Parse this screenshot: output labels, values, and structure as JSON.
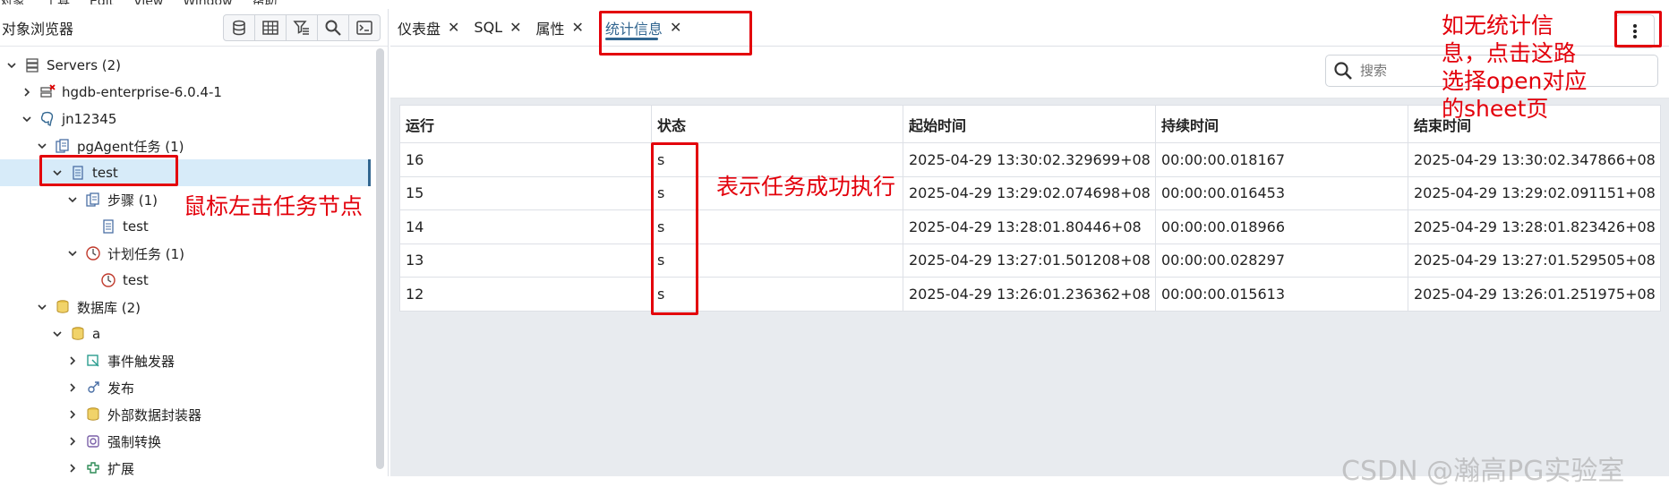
{
  "menubar": {
    "items": [
      "对象",
      "工具",
      "Edit",
      "View",
      "Window",
      "帮助"
    ]
  },
  "browser": {
    "title": "对象浏览器",
    "tools": [
      "database-icon",
      "table-icon",
      "filter-table-icon",
      "search-icon",
      "terminal-icon"
    ]
  },
  "tree": [
    {
      "label": "Servers (2)",
      "depth": 0,
      "chev": "down",
      "icon": "servers-icon"
    },
    {
      "label": "hgdb-enterprise-6.0.4-1",
      "depth": 1,
      "chev": "right",
      "icon": "server-disconnected-icon"
    },
    {
      "label": "jn12345",
      "depth": 1,
      "chev": "down",
      "icon": "postgres-elephant-icon"
    },
    {
      "label": "pgAgent任务 (1)",
      "depth": 2,
      "chev": "down",
      "icon": "jobs-icon"
    },
    {
      "label": "test",
      "depth": 3,
      "chev": "down",
      "icon": "job-icon",
      "selected": true
    },
    {
      "label": "步骤 (1)",
      "depth": 4,
      "chev": "down",
      "icon": "steps-icon"
    },
    {
      "label": "test",
      "depth": 5,
      "chev": "",
      "icon": "step-icon"
    },
    {
      "label": "计划任务 (1)",
      "depth": 4,
      "chev": "down",
      "icon": "schedules-icon"
    },
    {
      "label": "test",
      "depth": 5,
      "chev": "",
      "icon": "schedule-icon"
    },
    {
      "label": "数据库 (2)",
      "depth": 2,
      "chev": "down",
      "icon": "databases-icon"
    },
    {
      "label": "a",
      "depth": 3,
      "chev": "down",
      "icon": "database-icon"
    },
    {
      "label": "事件触发器",
      "depth": 4,
      "chev": "right",
      "icon": "event-trigger-icon"
    },
    {
      "label": "发布",
      "depth": 4,
      "chev": "right",
      "icon": "publication-icon"
    },
    {
      "label": "外部数据封装器",
      "depth": 4,
      "chev": "right",
      "icon": "foreign-data-wrapper-icon"
    },
    {
      "label": "强制转换",
      "depth": 4,
      "chev": "right",
      "icon": "cast-icon"
    },
    {
      "label": "扩展",
      "depth": 4,
      "chev": "right",
      "icon": "extension-icon"
    }
  ],
  "tabs": [
    {
      "label": "仪表盘",
      "active": false
    },
    {
      "label": "SQL",
      "active": false
    },
    {
      "label": "属性",
      "active": false
    },
    {
      "label": "统计信息",
      "active": true
    }
  ],
  "search": {
    "placeholder": "搜索"
  },
  "stats": {
    "headers": [
      "运行",
      "状态",
      "起始时间",
      "持续时间",
      "结束时间"
    ],
    "rows": [
      [
        "16",
        "s",
        "2025-04-29 13:30:02.329699+08",
        "00:00:00.018167",
        "2025-04-29 13:30:02.347866+08"
      ],
      [
        "15",
        "s",
        "2025-04-29 13:29:02.074698+08",
        "00:00:00.016453",
        "2025-04-29 13:29:02.091151+08"
      ],
      [
        "14",
        "s",
        "2025-04-29 13:28:01.80446+08",
        "00:00:00.018966",
        "2025-04-29 13:28:01.823426+08"
      ],
      [
        "13",
        "s",
        "2025-04-29 13:27:01.501208+08",
        "00:00:00.028297",
        "2025-04-29 13:27:01.529505+08"
      ],
      [
        "12",
        "s",
        "2025-04-29 13:26:01.236362+08",
        "00:00:00.015613",
        "2025-04-29 13:26:01.251975+08"
      ]
    ]
  },
  "annotations": {
    "click_node": "鼠标左击任务节点",
    "success": "表示任务成功执行",
    "no_stats_lines": [
      "如无统计信",
      "息，点击这路",
      "选择open对应",
      "的sheet页"
    ]
  },
  "watermark": "CSDN @瀚高PG实验室",
  "colors": {
    "accent": "#326690",
    "selected_bg": "#d7ebf9",
    "annotation": "#e3000b"
  }
}
